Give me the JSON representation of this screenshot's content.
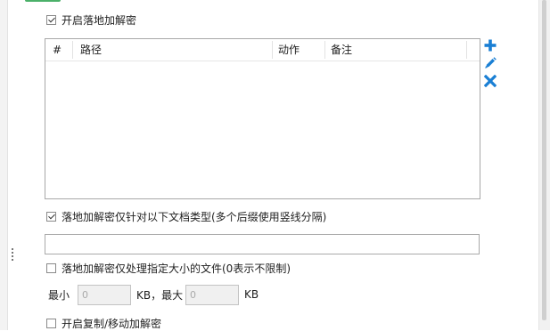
{
  "settings": {
    "enable_landing_decrypt": {
      "label": "开启落地加解密",
      "checked": true
    },
    "rules_table": {
      "columns": [
        "#",
        "路径",
        "动作",
        "备注"
      ],
      "rows": []
    },
    "toolbar": {
      "add": "plus-icon",
      "edit": "pencil-icon",
      "delete": "x-icon",
      "color": "#1a7fd4"
    },
    "filetype_restrict": {
      "label": "落地加解密仅针对以下文档类型(多个后缀使用竖线分隔)",
      "checked": true
    },
    "filetype_input": {
      "value": ""
    },
    "size_restrict": {
      "label": "落地加解密仅处理指定大小的文件(0表示不限制)",
      "checked": false
    },
    "size": {
      "min_label": "最小",
      "min_value": "0",
      "kb_unit_1": "KB，最大",
      "max_value": "0",
      "kb_unit_2": "KB"
    },
    "copy_move": {
      "label": "开启复制/移动加解密",
      "checked": false
    }
  },
  "accent_green": "#2ca24f"
}
